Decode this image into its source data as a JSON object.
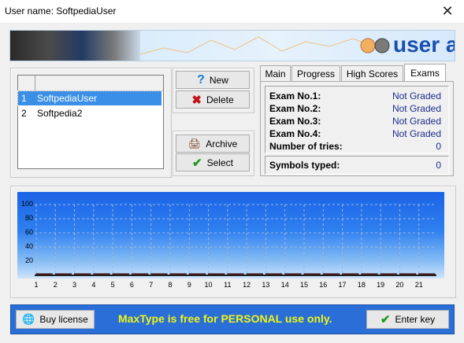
{
  "window": {
    "title": "User name: SoftpediaUser",
    "close_icon": "close-icon"
  },
  "banner": {
    "text": "user a"
  },
  "users": {
    "rows": [
      {
        "num": "1",
        "name": "SoftpediaUser",
        "selected": true
      },
      {
        "num": "2",
        "name": "Softpedia2",
        "selected": false
      }
    ]
  },
  "buttons": {
    "new": "New",
    "delete": "Delete",
    "archive": "Archive",
    "select": "Select",
    "buy_license": "Buy license",
    "enter_key": "Enter key"
  },
  "tabs": [
    {
      "label": "Main"
    },
    {
      "label": "Progress"
    },
    {
      "label": "High Scores"
    },
    {
      "label": "Exams",
      "active": true
    }
  ],
  "exams": [
    {
      "label": "Exam No.1:",
      "value": "Not Graded"
    },
    {
      "label": "Exam No.2:",
      "value": "Not Graded"
    },
    {
      "label": "Exam No.3:",
      "value": "Not Graded"
    },
    {
      "label": "Exam No.4:",
      "value": "Not Graded"
    },
    {
      "label": "Number of tries:",
      "value": "0"
    },
    {
      "label": "Symbols typed:",
      "value": "0"
    }
  ],
  "footer": {
    "text": "MaxType is free for PERSONAL use only."
  },
  "colors": {
    "accent_blue": "#1a4fb0",
    "footer_bg": "#2a6fd8",
    "footer_text": "#f1f513",
    "selected_row": "#3b8fe6"
  },
  "chart_data": {
    "type": "bar",
    "categories": [
      "1",
      "2",
      "3",
      "4",
      "5",
      "6",
      "7",
      "8",
      "9",
      "10",
      "11",
      "12",
      "13",
      "14",
      "15",
      "16",
      "17",
      "18",
      "19",
      "20",
      "21"
    ],
    "values": [
      0,
      0,
      0,
      0,
      0,
      0,
      0,
      0,
      0,
      0,
      0,
      0,
      0,
      0,
      0,
      0,
      0,
      0,
      0,
      0,
      0
    ],
    "yticks": [
      "100",
      "80",
      "60",
      "40",
      "20"
    ],
    "ylim": [
      0,
      100
    ],
    "grid": true
  }
}
